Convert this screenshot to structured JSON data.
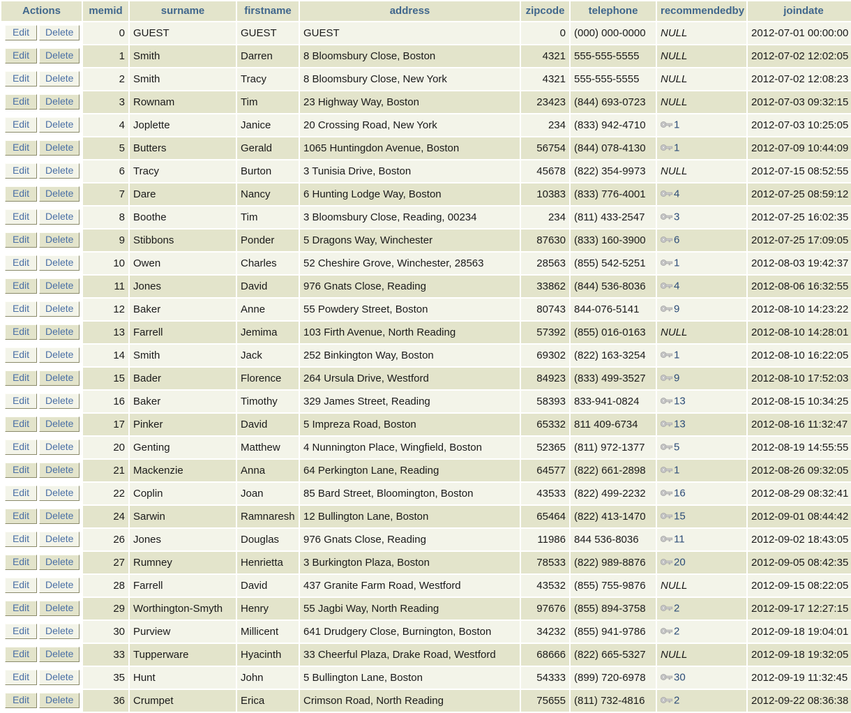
{
  "table": {
    "actions": {
      "header": "Actions",
      "edit_label": "Edit",
      "delete_label": "Delete"
    },
    "columns": [
      {
        "key": "memid",
        "label": "memid"
      },
      {
        "key": "surname",
        "label": "surname"
      },
      {
        "key": "firstname",
        "label": "firstname"
      },
      {
        "key": "address",
        "label": "address"
      },
      {
        "key": "zipcode",
        "label": "zipcode"
      },
      {
        "key": "telephone",
        "label": "telephone"
      },
      {
        "key": "recommendedby",
        "label": "recommendedby"
      },
      {
        "key": "joindate",
        "label": "joindate"
      }
    ],
    "null_text": "NULL",
    "fk_icon": "key-icon",
    "colors": {
      "header_bg": "#e3e4cb",
      "header_text": "#41678c",
      "row_odd_bg": "#f3f4e9",
      "row_even_bg": "#e3e4cb",
      "link": "#4a6fa5",
      "fk_link": "#2d4d78",
      "key_icon": "#a9a9a9"
    },
    "rows": [
      {
        "memid": "0",
        "surname": "GUEST",
        "firstname": "GUEST",
        "address": "GUEST",
        "zipcode": "0",
        "telephone": "(000) 000-0000",
        "recommendedby": null,
        "joindate": "2012-07-01 00:00:00"
      },
      {
        "memid": "1",
        "surname": "Smith",
        "firstname": "Darren",
        "address": "8 Bloomsbury Close, Boston",
        "zipcode": "4321",
        "telephone": "555-555-5555",
        "recommendedby": null,
        "joindate": "2012-07-02 12:02:05"
      },
      {
        "memid": "2",
        "surname": "Smith",
        "firstname": "Tracy",
        "address": "8 Bloomsbury Close, New York",
        "zipcode": "4321",
        "telephone": "555-555-5555",
        "recommendedby": null,
        "joindate": "2012-07-02 12:08:23"
      },
      {
        "memid": "3",
        "surname": "Rownam",
        "firstname": "Tim",
        "address": "23 Highway Way, Boston",
        "zipcode": "23423",
        "telephone": "(844) 693-0723",
        "recommendedby": null,
        "joindate": "2012-07-03 09:32:15"
      },
      {
        "memid": "4",
        "surname": "Joplette",
        "firstname": "Janice",
        "address": "20 Crossing Road, New York",
        "zipcode": "234",
        "telephone": "(833) 942-4710",
        "recommendedby": "1",
        "joindate": "2012-07-03 10:25:05"
      },
      {
        "memid": "5",
        "surname": "Butters",
        "firstname": "Gerald",
        "address": "1065 Huntingdon Avenue, Boston",
        "zipcode": "56754",
        "telephone": "(844) 078-4130",
        "recommendedby": "1",
        "joindate": "2012-07-09 10:44:09"
      },
      {
        "memid": "6",
        "surname": "Tracy",
        "firstname": "Burton",
        "address": "3 Tunisia Drive, Boston",
        "zipcode": "45678",
        "telephone": "(822) 354-9973",
        "recommendedby": null,
        "joindate": "2012-07-15 08:52:55"
      },
      {
        "memid": "7",
        "surname": "Dare",
        "firstname": "Nancy",
        "address": "6 Hunting Lodge Way, Boston",
        "zipcode": "10383",
        "telephone": "(833) 776-4001",
        "recommendedby": "4",
        "joindate": "2012-07-25 08:59:12"
      },
      {
        "memid": "8",
        "surname": "Boothe",
        "firstname": "Tim",
        "address": "3 Bloomsbury Close, Reading, 00234",
        "zipcode": "234",
        "telephone": "(811) 433-2547",
        "recommendedby": "3",
        "joindate": "2012-07-25 16:02:35"
      },
      {
        "memid": "9",
        "surname": "Stibbons",
        "firstname": "Ponder",
        "address": "5 Dragons Way, Winchester",
        "zipcode": "87630",
        "telephone": "(833) 160-3900",
        "recommendedby": "6",
        "joindate": "2012-07-25 17:09:05"
      },
      {
        "memid": "10",
        "surname": "Owen",
        "firstname": "Charles",
        "address": "52 Cheshire Grove, Winchester, 28563",
        "zipcode": "28563",
        "telephone": "(855) 542-5251",
        "recommendedby": "1",
        "joindate": "2012-08-03 19:42:37"
      },
      {
        "memid": "11",
        "surname": "Jones",
        "firstname": "David",
        "address": "976 Gnats Close, Reading",
        "zipcode": "33862",
        "telephone": "(844) 536-8036",
        "recommendedby": "4",
        "joindate": "2012-08-06 16:32:55"
      },
      {
        "memid": "12",
        "surname": "Baker",
        "firstname": "Anne",
        "address": "55 Powdery Street, Boston",
        "zipcode": "80743",
        "telephone": "844-076-5141",
        "recommendedby": "9",
        "joindate": "2012-08-10 14:23:22"
      },
      {
        "memid": "13",
        "surname": "Farrell",
        "firstname": "Jemima",
        "address": "103 Firth Avenue, North Reading",
        "zipcode": "57392",
        "telephone": "(855) 016-0163",
        "recommendedby": null,
        "joindate": "2012-08-10 14:28:01"
      },
      {
        "memid": "14",
        "surname": "Smith",
        "firstname": "Jack",
        "address": "252 Binkington Way, Boston",
        "zipcode": "69302",
        "telephone": "(822) 163-3254",
        "recommendedby": "1",
        "joindate": "2012-08-10 16:22:05"
      },
      {
        "memid": "15",
        "surname": "Bader",
        "firstname": "Florence",
        "address": "264 Ursula Drive, Westford",
        "zipcode": "84923",
        "telephone": "(833) 499-3527",
        "recommendedby": "9",
        "joindate": "2012-08-10 17:52:03"
      },
      {
        "memid": "16",
        "surname": "Baker",
        "firstname": "Timothy",
        "address": "329 James Street, Reading",
        "zipcode": "58393",
        "telephone": "833-941-0824",
        "recommendedby": "13",
        "joindate": "2012-08-15 10:34:25"
      },
      {
        "memid": "17",
        "surname": "Pinker",
        "firstname": "David",
        "address": "5 Impreza Road, Boston",
        "zipcode": "65332",
        "telephone": "811 409-6734",
        "recommendedby": "13",
        "joindate": "2012-08-16 11:32:47"
      },
      {
        "memid": "20",
        "surname": "Genting",
        "firstname": "Matthew",
        "address": "4 Nunnington Place, Wingfield, Boston",
        "zipcode": "52365",
        "telephone": "(811) 972-1377",
        "recommendedby": "5",
        "joindate": "2012-08-19 14:55:55"
      },
      {
        "memid": "21",
        "surname": "Mackenzie",
        "firstname": "Anna",
        "address": "64 Perkington Lane, Reading",
        "zipcode": "64577",
        "telephone": "(822) 661-2898",
        "recommendedby": "1",
        "joindate": "2012-08-26 09:32:05"
      },
      {
        "memid": "22",
        "surname": "Coplin",
        "firstname": "Joan",
        "address": "85 Bard Street, Bloomington, Boston",
        "zipcode": "43533",
        "telephone": "(822) 499-2232",
        "recommendedby": "16",
        "joindate": "2012-08-29 08:32:41"
      },
      {
        "memid": "24",
        "surname": "Sarwin",
        "firstname": "Ramnaresh",
        "address": "12 Bullington Lane, Boston",
        "zipcode": "65464",
        "telephone": "(822) 413-1470",
        "recommendedby": "15",
        "joindate": "2012-09-01 08:44:42"
      },
      {
        "memid": "26",
        "surname": "Jones",
        "firstname": "Douglas",
        "address": "976 Gnats Close, Reading",
        "zipcode": "11986",
        "telephone": "844 536-8036",
        "recommendedby": "11",
        "joindate": "2012-09-02 18:43:05"
      },
      {
        "memid": "27",
        "surname": "Rumney",
        "firstname": "Henrietta",
        "address": "3 Burkington Plaza, Boston",
        "zipcode": "78533",
        "telephone": "(822) 989-8876",
        "recommendedby": "20",
        "joindate": "2012-09-05 08:42:35"
      },
      {
        "memid": "28",
        "surname": "Farrell",
        "firstname": "David",
        "address": "437 Granite Farm Road, Westford",
        "zipcode": "43532",
        "telephone": "(855) 755-9876",
        "recommendedby": null,
        "joindate": "2012-09-15 08:22:05"
      },
      {
        "memid": "29",
        "surname": "Worthington-Smyth",
        "firstname": "Henry",
        "address": "55 Jagbi Way, North Reading",
        "zipcode": "97676",
        "telephone": "(855) 894-3758",
        "recommendedby": "2",
        "joindate": "2012-09-17 12:27:15"
      },
      {
        "memid": "30",
        "surname": "Purview",
        "firstname": "Millicent",
        "address": "641 Drudgery Close, Burnington, Boston",
        "zipcode": "34232",
        "telephone": "(855) 941-9786",
        "recommendedby": "2",
        "joindate": "2012-09-18 19:04:01"
      },
      {
        "memid": "33",
        "surname": "Tupperware",
        "firstname": "Hyacinth",
        "address": "33 Cheerful Plaza, Drake Road, Westford",
        "zipcode": "68666",
        "telephone": "(822) 665-5327",
        "recommendedby": null,
        "joindate": "2012-09-18 19:32:05"
      },
      {
        "memid": "35",
        "surname": "Hunt",
        "firstname": "John",
        "address": "5 Bullington Lane, Boston",
        "zipcode": "54333",
        "telephone": "(899) 720-6978",
        "recommendedby": "30",
        "joindate": "2012-09-19 11:32:45"
      },
      {
        "memid": "36",
        "surname": "Crumpet",
        "firstname": "Erica",
        "address": "Crimson Road, North Reading",
        "zipcode": "75655",
        "telephone": "(811) 732-4816",
        "recommendedby": "2",
        "joindate": "2012-09-22 08:36:38"
      }
    ]
  }
}
